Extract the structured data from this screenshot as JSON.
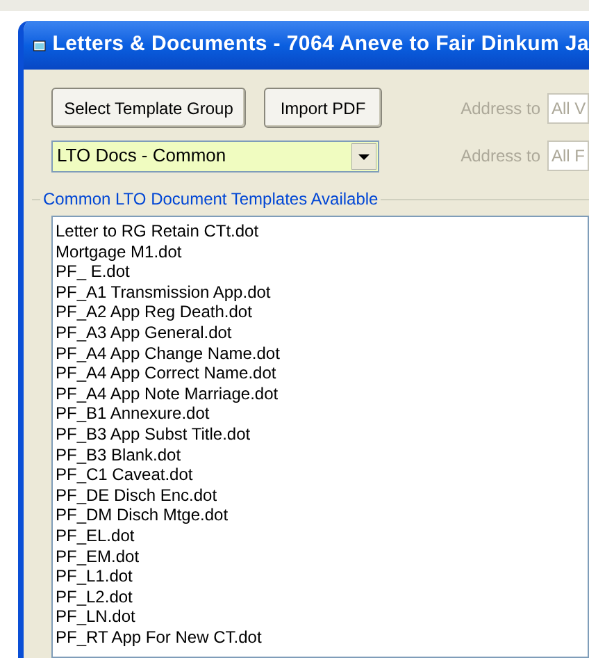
{
  "window": {
    "title": "Letters & Documents - 7064 Aneve to Fair Dinkum Ja"
  },
  "buttons": [
    "Select Template Group",
    "Import PDF"
  ],
  "template_group": {
    "value": "LTO Docs - Common"
  },
  "address_fields": [
    {
      "label": "Address to",
      "value": "All V",
      "disabled": true
    },
    {
      "label": "Address to",
      "value": "All F",
      "disabled": true
    }
  ],
  "templates": {
    "title": "Common LTO Document Templates Available",
    "items": [
      "Letter to RG Retain CTt.dot",
      "Mortgage M1.dot",
      "PF_ E.dot",
      "PF_A1 Transmission App.dot",
      "PF_A2 App Reg Death.dot",
      "PF_A3 App General.dot",
      "PF_A4 App Change Name.dot",
      "PF_A4 App Correct Name.dot",
      "PF_A4 App Note Marriage.dot",
      "PF_B1 Annexure.dot",
      "PF_B3 App Subst Title.dot",
      "PF_B3 Blank.dot",
      "PF_C1  Caveat.dot",
      "PF_DE Disch Enc.dot",
      "PF_DM Disch Mtge.dot",
      "PF_EL.dot",
      "PF_EM.dot",
      "PF_L1.dot",
      "PF_L2.dot",
      "PF_LN.dot",
      "PF_RT App For New CT.dot"
    ]
  }
}
